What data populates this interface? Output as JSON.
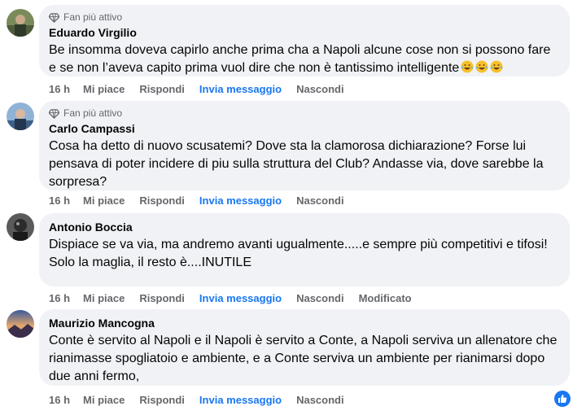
{
  "comments": [
    {
      "badge": "Fan più attivo",
      "author": "Eduardo Virgilio",
      "text": "Be insomma doveva capirlo anche prima cha a Napoli alcune cose non si possono fare e se non l’aveva capito prima vuol dire che non è tantissimo intelligente",
      "emojis": [
        "rofl-emoji",
        "rofl-emoji",
        "rofl-emoji"
      ],
      "actions": {
        "time": "16 h",
        "like": "Mi piace",
        "reply": "Rispondi",
        "message": "Invia messaggio",
        "hide": "Nascondi",
        "edited": ""
      }
    },
    {
      "badge": "Fan più attivo",
      "author": "Carlo Campassi",
      "text": "Cosa ha detto di nuovo scusatemi? Dove sta la clamorosa dichiarazione? Forse lui pensava di poter incidere di piu sulla struttura del Club? Andasse via, dove sarebbe la sorpresa?",
      "actions": {
        "time": "16 h",
        "like": "Mi piace",
        "reply": "Rispondi",
        "message": "Invia messaggio",
        "hide": "Nascondi",
        "edited": ""
      }
    },
    {
      "badge": "",
      "author": "Antonio Boccia",
      "text_lines": [
        "Dispiace se va via, ma andremo avanti ugualmente.....e sempre più competitivi e tifosi!",
        "Solo la maglia, il resto è....INUTILE"
      ],
      "actions": {
        "time": "16 h",
        "like": "Mi piace",
        "reply": "Rispondi",
        "message": "Invia messaggio",
        "hide": "Nascondi",
        "edited": "Modificato"
      }
    },
    {
      "badge": "",
      "author": "Maurizio Mancogna",
      "text": "Conte è servito al Napoli e il Napoli è servito a Conte, a Napoli serviva un allenatore che rianimasse spogliatoio e ambiente, e a Conte serviva un ambiente per rianimarsi dopo due anni fermo,",
      "actions": {
        "time": "16 h",
        "like": "Mi piace",
        "reply": "Rispondi",
        "message": "Invia messaggio",
        "hide": "Nascondi",
        "edited": ""
      }
    }
  ],
  "colors": {
    "bubble": "#f0f2f5",
    "accent": "#1877f2",
    "secondary_text": "#65676b"
  },
  "reaction_icon": "thumbs-up-icon"
}
